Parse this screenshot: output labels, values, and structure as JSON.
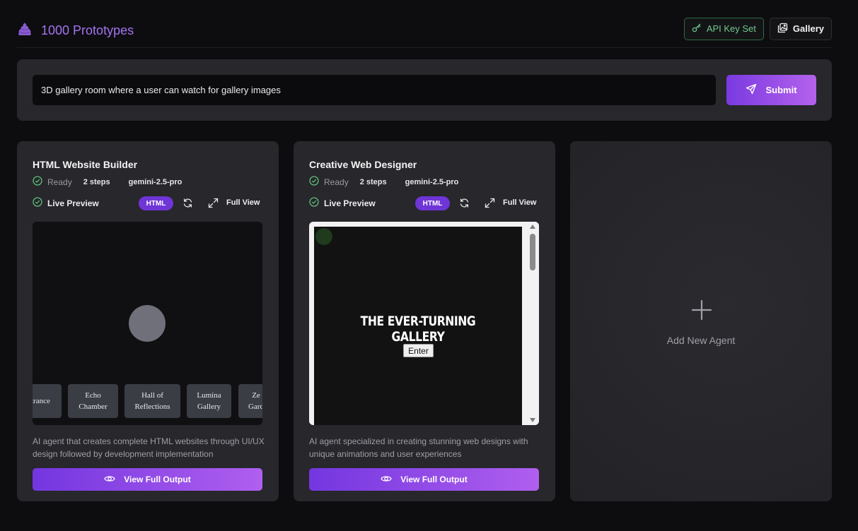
{
  "header": {
    "title": "1000 Prototypes",
    "logo_icon": "poop-icon",
    "api_key_label": "API Key Set",
    "gallery_label": "Gallery"
  },
  "prompt": {
    "value": "3D gallery room where a user can watch for gallery images",
    "submit_label": "Submit"
  },
  "agents": [
    {
      "title": "HTML Website Builder",
      "status": "Ready",
      "steps": "2 steps",
      "model": "gemini-2.5-pro",
      "preview_label": "Live Preview",
      "badge": "HTML",
      "full_view_label": "Full View",
      "description": "AI agent that creates complete HTML websites through UI/UX design followed by development implementation",
      "view_button": "View Full Output",
      "preview": {
        "rooms": [
          "trance",
          "Echo Chamber",
          "Hall of Reflections",
          "Lumina Gallery",
          "Ze Gard"
        ]
      }
    },
    {
      "title": "Creative Web Designer",
      "status": "Ready",
      "steps": "2 steps",
      "model": "gemini-2.5-pro",
      "preview_label": "Live Preview",
      "badge": "HTML",
      "full_view_label": "Full View",
      "description": "AI agent specialized in creating stunning web designs with unique animations and user experiences",
      "view_button": "View Full Output",
      "preview": {
        "heading": "THE EVER-TURNING GALLERY",
        "button": "Enter"
      }
    }
  ],
  "add_agent": {
    "label": "Add New Agent"
  },
  "colors": {
    "accent": "#7a3ae0",
    "accent_light": "#b462ec",
    "success": "#6fc98a",
    "card_bg": "#27272c",
    "page_bg": "#0d0d10"
  }
}
